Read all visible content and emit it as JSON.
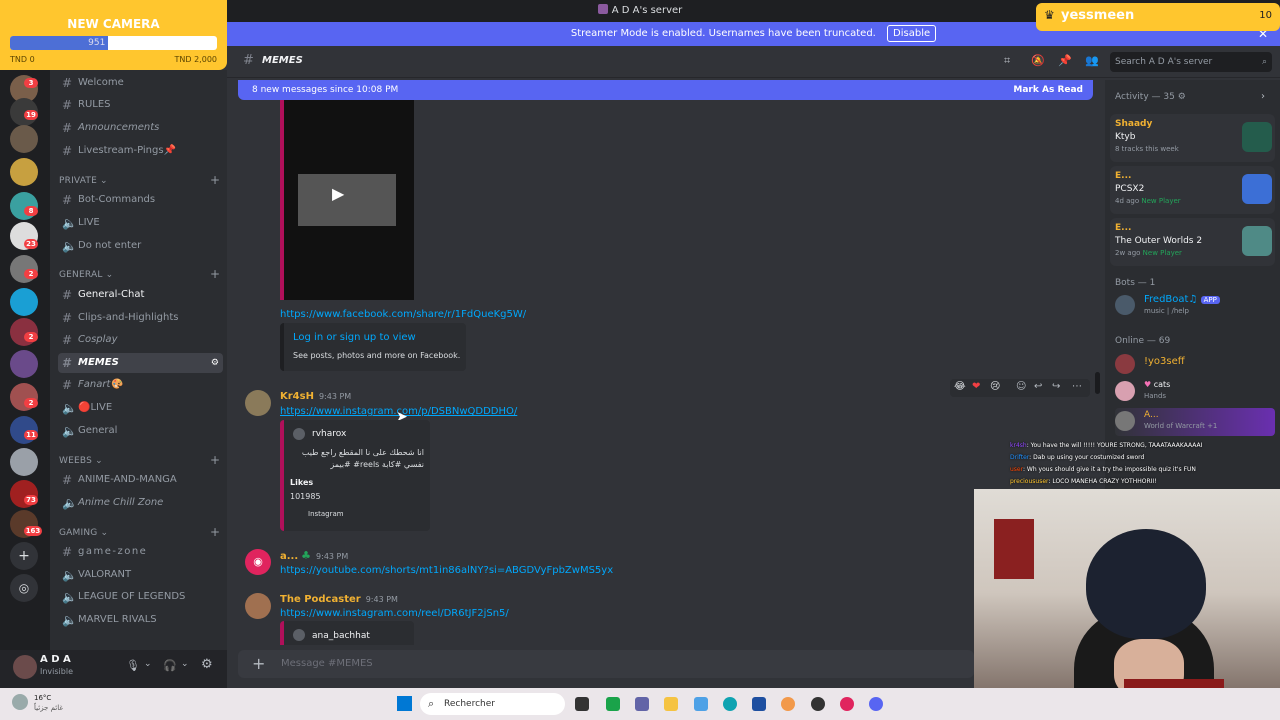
{
  "window": {
    "title": "A D A's server"
  },
  "banner": {
    "text": "Streamer Mode is enabled. Usernames have been truncated.",
    "disable": "Disable"
  },
  "overlay": {
    "camera_goal": {
      "title": "NEW CAMERA",
      "current": "951",
      "min": "TND 0",
      "max": "TND 2,000",
      "progress": 0.4755
    },
    "tag": {
      "name": "yessmeen",
      "count": "10"
    }
  },
  "guild_badges": [
    "3",
    "19",
    "8",
    "23",
    "2",
    "2",
    "2",
    "2",
    "11",
    "73",
    "163"
  ],
  "channels": {
    "items": [
      {
        "label": "Welcome",
        "icon": "#"
      },
      {
        "label": "RULES",
        "icon": "#"
      },
      {
        "label": "Announcements",
        "icon": "#"
      },
      {
        "label": "Livestream-Pings📌",
        "icon": "#"
      }
    ],
    "private": {
      "title": "PRIVATE",
      "items": [
        "Bot-Commands",
        "LIVE",
        "Do not enter"
      ]
    },
    "general": {
      "title": "GENERAL",
      "items": [
        "General-Chat",
        "Clips-and-Highlights",
        "Cosplay",
        "MEMES",
        "Fanart🎨",
        "🔴LIVE",
        "General"
      ]
    },
    "weebs": {
      "title": "WEEBS",
      "items": [
        "ANIME-AND-MANGA",
        "Anime Chill Zone"
      ]
    },
    "gaming": {
      "title": "GAMING",
      "items": [
        "game-zone",
        "VALORANT",
        "LEAGUE OF LEGENDS",
        "MARVEL RIVALS"
      ]
    }
  },
  "user": {
    "name": "A D A",
    "status": "Invisible"
  },
  "header": {
    "channel": "MEMES",
    "search_placeholder": "Search A D A's server"
  },
  "new_messages": {
    "text": "8 new messages since 10:08 PM",
    "mark": "Mark As Read"
  },
  "messages": [
    {
      "link": "https://www.facebook.com/share/r/1FdQueKg5W/",
      "embed_title": "Log in or sign up to view",
      "embed_desc": "See posts, photos and more on Facebook."
    },
    {
      "user": "Kr4sH",
      "time": "9:43 PM",
      "link": "https://www.instagram.com/p/DSBNwQDDDHO/",
      "embed_author": "rvharox",
      "embed_text": "انا شحطك على نا المقطع راجع طيب نفسي #كابة reels# #بيمز",
      "likes_label": "Likes",
      "likes": "101985",
      "footer": "Instagram"
    },
    {
      "user": "a...",
      "time": "9:43 PM",
      "link": "https://youtube.com/shorts/mt1in86alNY?si=ABGDVyFpbZwMS5yx"
    },
    {
      "user": "The Podcaster",
      "time": "9:43 PM",
      "link": "https://www.instagram.com/reel/DR6tJF2jSn5/",
      "embed_author": "ana_bachhat"
    }
  ],
  "composer": {
    "placeholder": "Message #MEMES"
  },
  "members": {
    "activity_title": "Activity — 35",
    "activity": [
      {
        "name": "Shaady",
        "title": "Ktyb",
        "sub": "8 tracks this week"
      },
      {
        "name": "E...",
        "title": "PCSX2",
        "sub": "4d ago",
        "tag": "New Player"
      },
      {
        "name": "E...",
        "title": "The Outer Worlds 2",
        "sub": "2w ago",
        "tag": "New Player"
      }
    ],
    "bots_title": "Bots — 1",
    "bot": {
      "name": "FredBoat♫",
      "badge": "APP",
      "status": "music | /help"
    },
    "online_title": "Online — 69",
    "online": [
      {
        "name": "!yo3seff",
        "status": ""
      },
      {
        "name": "cats",
        "status": "Hands"
      },
      {
        "name": "A...",
        "status": "World of Warcraft +1"
      }
    ]
  },
  "stream_chat": [
    {
      "user": "kr4sh",
      "msg": ": You have the will !!!!! YOURE STRONG, TAAATAAAKAAAAI"
    },
    {
      "user": "Drifter",
      "msg": ": Dab up using your costumized sword"
    },
    {
      "user": "user",
      "msg": ": Wh yous should give it a try the impossible quiz it's FUN"
    },
    {
      "user": "precioususer",
      "msg": ": LOCO MANEHA CRAZY YOTHHORII!"
    }
  ],
  "taskbar": {
    "weather_temp": "16°C",
    "weather_desc": "غائم جزئياً",
    "search": "Rechercher"
  }
}
